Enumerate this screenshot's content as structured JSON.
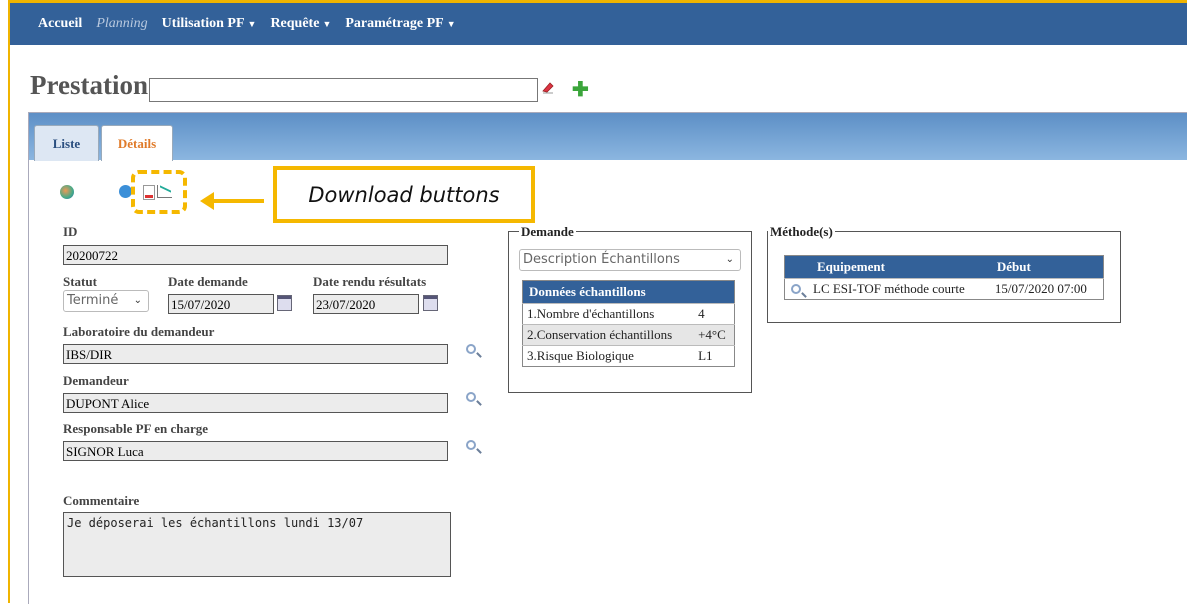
{
  "nav": {
    "items": [
      {
        "label": "Accueil",
        "dropdown": false
      },
      {
        "label": "Planning",
        "dropdown": false,
        "muted": true
      },
      {
        "label": "Utilisation PF",
        "dropdown": true
      },
      {
        "label": "Requête",
        "dropdown": true
      },
      {
        "label": "Paramétrage PF",
        "dropdown": true
      }
    ]
  },
  "header": {
    "title": "Prestation",
    "search_value": ""
  },
  "tabs": {
    "liste": "Liste",
    "details": "Détails"
  },
  "annotation": {
    "callout": "Download buttons"
  },
  "form": {
    "id_label": "ID",
    "id_value": "20200722",
    "statut_label": "Statut",
    "statut_value": "Terminé",
    "date_demande_label": "Date demande",
    "date_demande_value": "15/07/2020",
    "date_rendu_label": "Date rendu résultats",
    "date_rendu_value": "23/07/2020",
    "labo_label": "Laboratoire du demandeur",
    "labo_value": "IBS/DIR",
    "demandeur_label": "Demandeur",
    "demandeur_value": "DUPONT Alice",
    "responsable_label": "Responsable PF en charge",
    "responsable_value": "SIGNOR Luca",
    "commentaire_label": "Commentaire",
    "commentaire_value": "Je déposerai les échantillons lundi 13/07"
  },
  "demande": {
    "legend": "Demande",
    "select_value": "Description Échantillons",
    "table_header": "Données échantillons",
    "rows": [
      {
        "name": "1.Nombre d'échantillons",
        "value": "4"
      },
      {
        "name": "2.Conservation échantillons",
        "value": "+4°C"
      },
      {
        "name": "3.Risque Biologique",
        "value": "L1"
      }
    ]
  },
  "methodes": {
    "legend": "Méthode(s)",
    "col_equipement": "Equipement",
    "col_debut": "Début",
    "rows": [
      {
        "equipement": "LC ESI-TOF méthode courte",
        "debut": "15/07/2020 07:00"
      }
    ]
  },
  "colors": {
    "navbar": "#336199",
    "highlight": "#f5b800",
    "active_tab": "#e07b2a"
  }
}
